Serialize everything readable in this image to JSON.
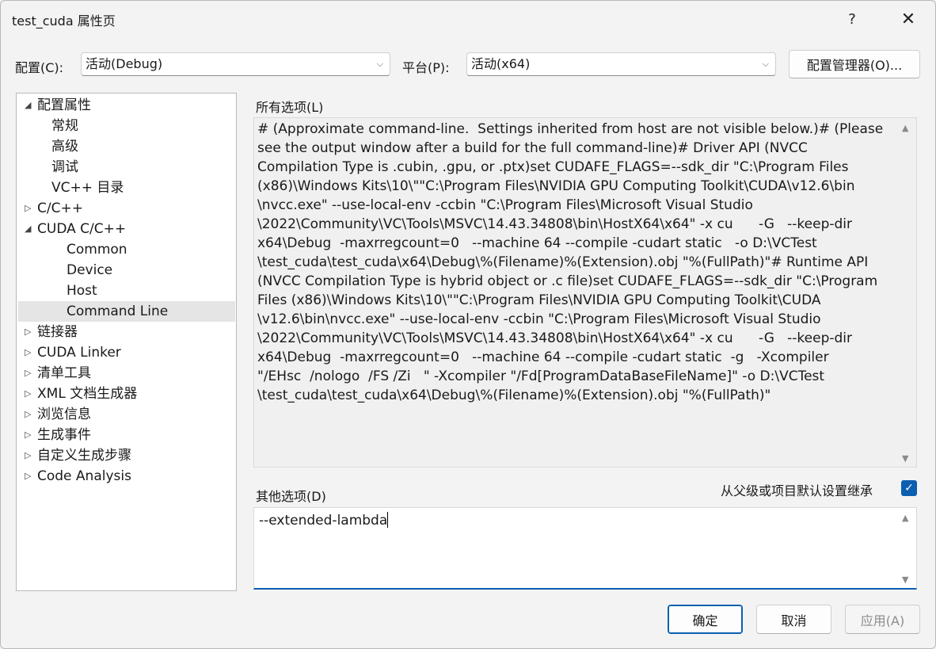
{
  "window": {
    "title": "test_cuda 属性页",
    "help": "?",
    "close": "✕"
  },
  "config": {
    "config_label": "配置(C):",
    "config_value": "活动(Debug)",
    "platform_label": "平台(P):",
    "platform_value": "活动(x64)",
    "manager_button": "配置管理器(O)..."
  },
  "tree": {
    "items": [
      {
        "label": "配置属性",
        "expander": "◢"
      },
      {
        "label": "常规",
        "expander": ""
      },
      {
        "label": "高级",
        "expander": ""
      },
      {
        "label": "调试",
        "expander": ""
      },
      {
        "label": "VC++ 目录",
        "expander": ""
      },
      {
        "label": "C/C++",
        "expander": "▷"
      },
      {
        "label": "CUDA C/C++",
        "expander": "◢"
      },
      {
        "label": "Common",
        "expander": ""
      },
      {
        "label": "Device",
        "expander": ""
      },
      {
        "label": "Host",
        "expander": ""
      },
      {
        "label": "Command Line",
        "expander": ""
      },
      {
        "label": "链接器",
        "expander": "▷"
      },
      {
        "label": "CUDA Linker",
        "expander": "▷"
      },
      {
        "label": "清单工具",
        "expander": "▷"
      },
      {
        "label": "XML 文档生成器",
        "expander": "▷"
      },
      {
        "label": "浏览信息",
        "expander": "▷"
      },
      {
        "label": "生成事件",
        "expander": "▷"
      },
      {
        "label": "自定义生成步骤",
        "expander": "▷"
      },
      {
        "label": "Code Analysis",
        "expander": "▷"
      }
    ],
    "selected": "Command Line"
  },
  "all_options": {
    "label": "所有选项(L)",
    "lines": [
      "# (Approximate command-line.  Settings inherited from host are not visible below.)# (Please",
      "see the output window after a build for the full command-line)# Driver API (NVCC",
      "Compilation Type is .cubin, .gpu, or .ptx)set CUDAFE_FLAGS=--sdk_dir \"C:\\Program Files",
      "(x86)\\Windows Kits\\10\\\"\"C:\\Program Files\\NVIDIA GPU Computing Toolkit\\CUDA\\v12.6\\bin",
      "\\nvcc.exe\" --use-local-env -ccbin \"C:\\Program Files\\Microsoft Visual Studio",
      "\\2022\\Community\\VC\\Tools\\MSVC\\14.43.34808\\bin\\HostX64\\x64\" -x cu      -G   --keep-dir",
      "x64\\Debug  -maxrregcount=0   --machine 64 --compile -cudart static   -o D:\\VCTest",
      "\\test_cuda\\test_cuda\\x64\\Debug\\%(Filename)%(Extension).obj \"%(FullPath)\"# Runtime API",
      "(NVCC Compilation Type is hybrid object or .c file)set CUDAFE_FLAGS=--sdk_dir \"C:\\Program",
      "Files (x86)\\Windows Kits\\10\\\"\"C:\\Program Files\\NVIDIA GPU Computing Toolkit\\CUDA",
      "\\v12.6\\bin\\nvcc.exe\" --use-local-env -ccbin \"C:\\Program Files\\Microsoft Visual Studio",
      "\\2022\\Community\\VC\\Tools\\MSVC\\14.43.34808\\bin\\HostX64\\x64\" -x cu      -G   --keep-dir",
      "x64\\Debug  -maxrregcount=0   --machine 64 --compile -cudart static  -g   -Xcompiler",
      "\"/EHsc  /nologo  /FS /Zi   \" -Xcompiler \"/Fd[ProgramDataBaseFileName]\" -o D:\\VCTest",
      "\\test_cuda\\test_cuda\\x64\\Debug\\%(Filename)%(Extension).obj \"%(FullPath)\""
    ]
  },
  "additional_options": {
    "label": "其他选项(D)",
    "value": "--extended-lambda",
    "inherit_label": "从父级或项目默认设置继承",
    "inherit_checked": true
  },
  "buttons": {
    "ok": "确定",
    "cancel": "取消",
    "apply": "应用(A)"
  },
  "colors": {
    "accent": "#0a5fb0",
    "selected_bg": "#e5e5e5"
  }
}
